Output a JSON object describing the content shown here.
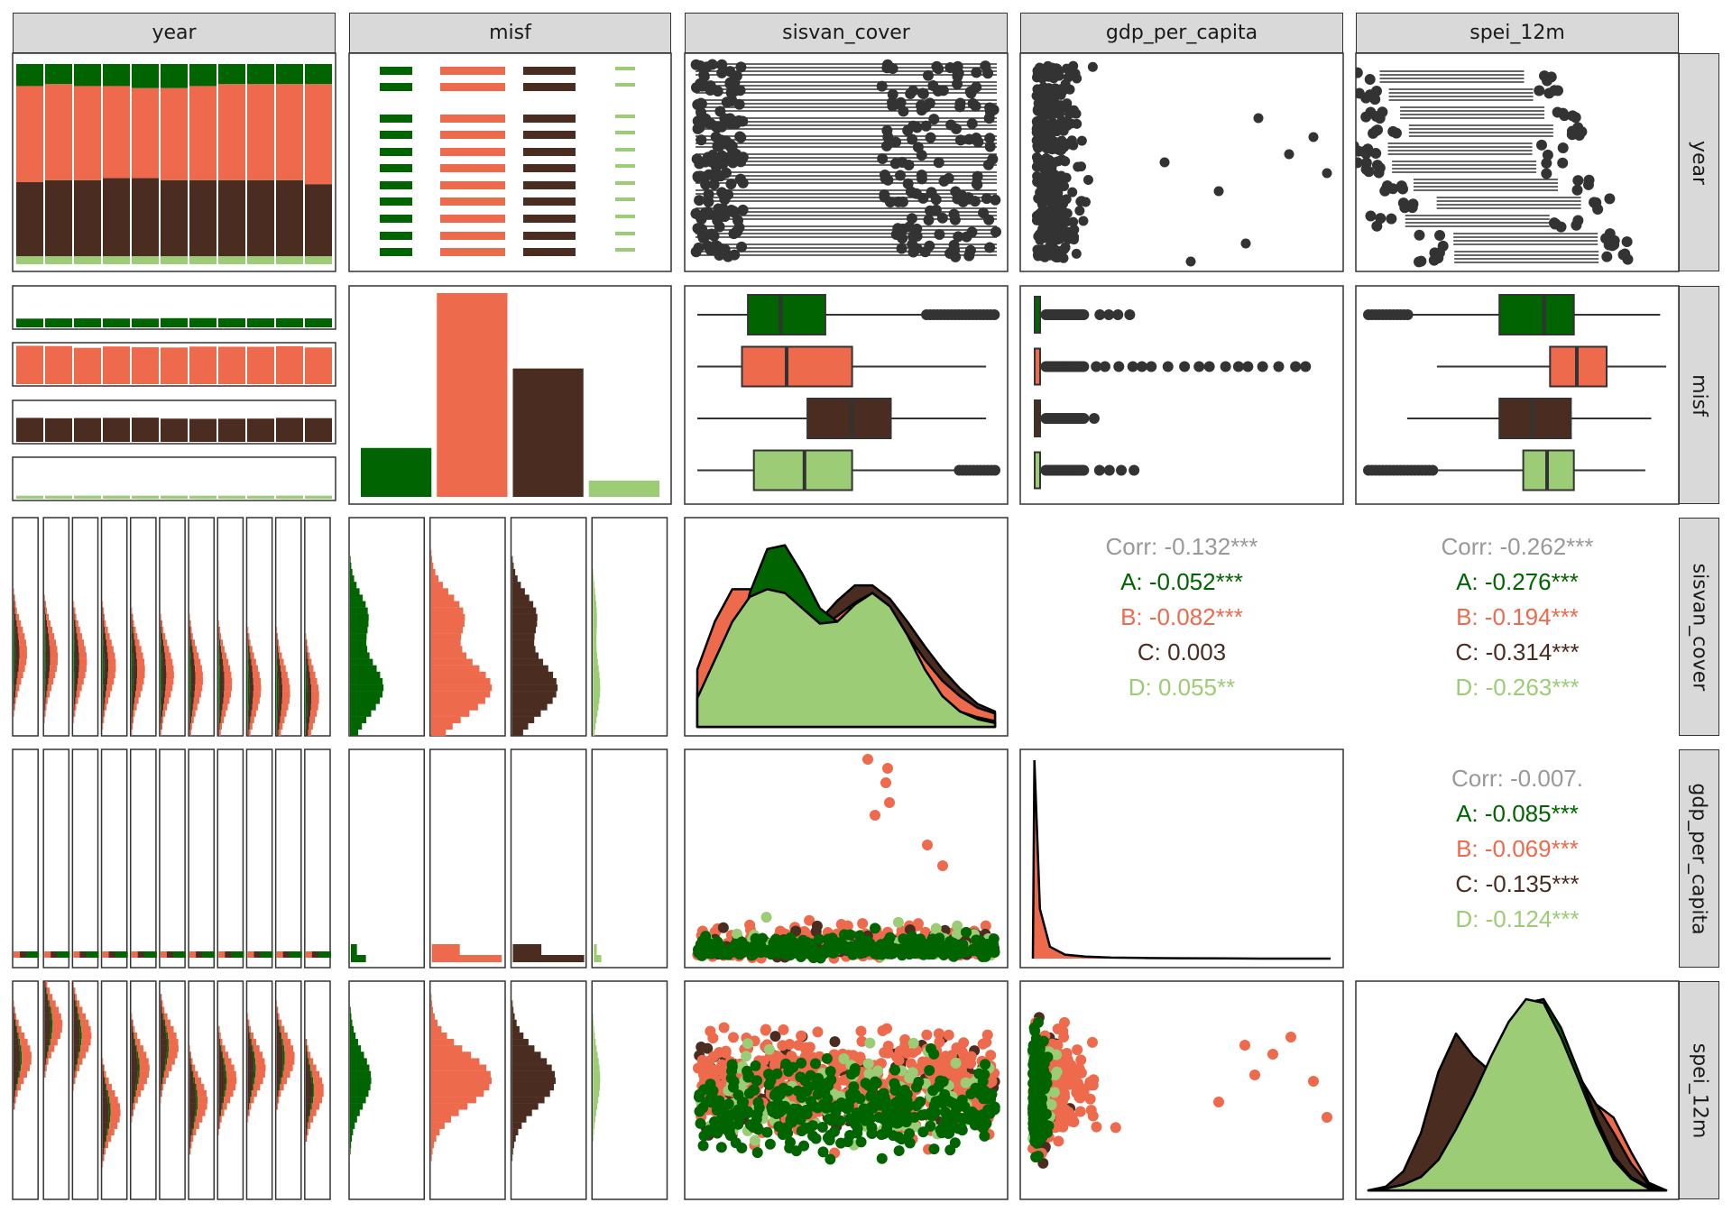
{
  "colors": {
    "A": "#006400",
    "B": "#ee6a4d",
    "C": "#4b2c20",
    "D": "#9ccd76",
    "corr": "#999999"
  },
  "variables": [
    "year",
    "misf",
    "sisvan_cover",
    "gdp_per_capita",
    "spei_12m"
  ],
  "groups": [
    "A",
    "B",
    "C",
    "D"
  ],
  "correlations": [
    {
      "row": 2,
      "col": 3,
      "corr": "Corr: -0.132***",
      "A": "A: -0.052***",
      "B": "B: -0.082***",
      "C": "C: 0.003",
      "D": "D: 0.055**"
    },
    {
      "row": 2,
      "col": 4,
      "corr": "Corr: -0.262***",
      "A": "A: -0.276***",
      "B": "B: -0.194***",
      "C": "C: -0.314***",
      "D": "D: -0.263***"
    },
    {
      "row": 3,
      "col": 4,
      "corr": "Corr: -0.007.",
      "A": "A: -0.085***",
      "B": "B: -0.069***",
      "C": "C: -0.135***",
      "D": "D: -0.124***"
    }
  ],
  "chart_data": {
    "type": "pairs-matrix",
    "variables": [
      "year",
      "misf",
      "sisvan_cover",
      "gdp_per_capita",
      "spei_12m"
    ],
    "group_variable": "misf",
    "groups": [
      "A",
      "B",
      "C",
      "D"
    ],
    "year_composition": {
      "n_years": 11,
      "shares": [
        {
          "A": 0.11,
          "B": 0.48,
          "C": 0.37,
          "D": 0.04
        },
        {
          "A": 0.1,
          "B": 0.48,
          "C": 0.38,
          "D": 0.04
        },
        {
          "A": 0.11,
          "B": 0.47,
          "C": 0.38,
          "D": 0.04
        },
        {
          "A": 0.11,
          "B": 0.46,
          "C": 0.39,
          "D": 0.04
        },
        {
          "A": 0.12,
          "B": 0.45,
          "C": 0.39,
          "D": 0.04
        },
        {
          "A": 0.12,
          "B": 0.46,
          "C": 0.38,
          "D": 0.04
        },
        {
          "A": 0.11,
          "B": 0.47,
          "C": 0.38,
          "D": 0.04
        },
        {
          "A": 0.1,
          "B": 0.48,
          "C": 0.38,
          "D": 0.04
        },
        {
          "A": 0.1,
          "B": 0.48,
          "C": 0.38,
          "D": 0.04
        },
        {
          "A": 0.1,
          "B": 0.48,
          "C": 0.38,
          "D": 0.04
        },
        {
          "A": 0.1,
          "B": 0.5,
          "C": 0.36,
          "D": 0.04
        }
      ]
    },
    "misf_counts": {
      "A": 0.24,
      "B": 1.0,
      "C": 0.63,
      "D": 0.08
    },
    "sisvan_cover_box": [
      {
        "group": "A",
        "q1": 0.17,
        "median": 0.28,
        "q3": 0.43,
        "lo": 0.0,
        "hi": 0.77,
        "out_lo": 0.77,
        "out_hi": 1.0
      },
      {
        "group": "B",
        "q1": 0.15,
        "median": 0.3,
        "q3": 0.52,
        "lo": 0.0,
        "hi": 0.97
      },
      {
        "group": "C",
        "q1": 0.37,
        "median": 0.52,
        "q3": 0.65,
        "lo": 0.0,
        "hi": 0.97
      },
      {
        "group": "D",
        "q1": 0.19,
        "median": 0.36,
        "q3": 0.52,
        "lo": 0.0,
        "hi": 0.88,
        "out_lo": 0.88,
        "out_hi": 1.0
      }
    ],
    "spei_12m_box": [
      {
        "group": "A",
        "q1": 0.44,
        "median": 0.59,
        "q3": 0.69,
        "lo": 0.12,
        "hi": 0.98,
        "out_lo": 0.0,
        "out_hi": 0.14
      },
      {
        "group": "B",
        "q1": 0.61,
        "median": 0.7,
        "q3": 0.8,
        "lo": 0.23,
        "hi": 1.0
      },
      {
        "group": "C",
        "q1": 0.44,
        "median": 0.55,
        "q3": 0.68,
        "lo": 0.13,
        "hi": 0.95
      },
      {
        "group": "D",
        "q1": 0.52,
        "median": 0.6,
        "q3": 0.69,
        "lo": 0.1,
        "hi": 0.93,
        "out_lo": 0.0,
        "out_hi": 0.22
      }
    ],
    "sisvan_cover_density": {
      "A": [
        0.0,
        0.05,
        0.3,
        0.7,
        0.93,
        0.95,
        0.8,
        0.62,
        0.55,
        0.62,
        0.7,
        0.62,
        0.45,
        0.28,
        0.16,
        0.08,
        0.05,
        0.03
      ],
      "B": [
        0.3,
        0.55,
        0.72,
        0.72,
        0.66,
        0.58,
        0.52,
        0.52,
        0.58,
        0.65,
        0.7,
        0.63,
        0.48,
        0.35,
        0.24,
        0.16,
        0.1,
        0.07
      ],
      "C": [
        0.18,
        0.32,
        0.45,
        0.52,
        0.55,
        0.55,
        0.52,
        0.56,
        0.66,
        0.74,
        0.74,
        0.67,
        0.55,
        0.42,
        0.3,
        0.2,
        0.12,
        0.08
      ],
      "D": [
        0.15,
        0.35,
        0.55,
        0.68,
        0.72,
        0.7,
        0.62,
        0.54,
        0.55,
        0.64,
        0.7,
        0.63,
        0.48,
        0.3,
        0.16,
        0.08,
        0.04,
        0.02
      ]
    },
    "spei_12m_density": {
      "A": [
        0.0,
        0.01,
        0.03,
        0.07,
        0.15,
        0.3,
        0.48,
        0.67,
        0.85,
        0.98,
        1.0,
        0.85,
        0.62,
        0.38,
        0.18,
        0.07,
        0.02,
        0.0
      ],
      "B": [
        0.0,
        0.01,
        0.03,
        0.07,
        0.15,
        0.3,
        0.48,
        0.65,
        0.82,
        0.97,
        1.0,
        0.82,
        0.6,
        0.45,
        0.38,
        0.2,
        0.04,
        0.0
      ],
      "C": [
        0.0,
        0.02,
        0.1,
        0.3,
        0.62,
        0.82,
        0.7,
        0.62,
        0.78,
        0.95,
        0.9,
        0.78,
        0.6,
        0.45,
        0.3,
        0.14,
        0.03,
        0.0
      ],
      "D": [
        0.0,
        0.01,
        0.03,
        0.07,
        0.16,
        0.32,
        0.5,
        0.7,
        0.88,
        1.0,
        0.98,
        0.8,
        0.58,
        0.35,
        0.16,
        0.06,
        0.01,
        0.0
      ]
    },
    "gdp_per_capita_density": [
      0.0,
      1.0,
      0.25,
      0.06,
      0.02,
      0.01,
      0.005,
      0.003,
      0.002,
      0.001,
      0.0,
      0.0
    ]
  }
}
